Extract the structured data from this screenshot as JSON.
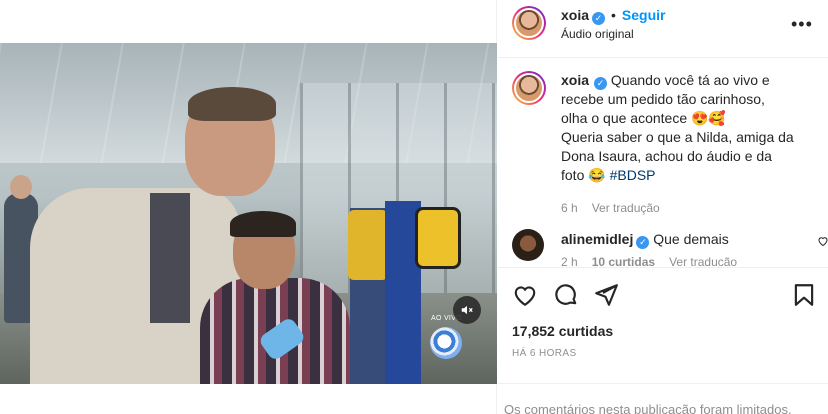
{
  "post_author": {
    "username": "xoia",
    "follow_label": "Seguir",
    "separator": "•",
    "audio_label": "Áudio original",
    "more_icon": "more-horizontal-icon",
    "more_label": "•••"
  },
  "video": {
    "overlay_text": "AO VIVO",
    "mute_icon": "speaker-muted-icon"
  },
  "caption": {
    "username": "xoia",
    "text_lines": [
      "Quando você tá ao vivo e",
      "recebe um pedido tão carinhoso,",
      "olha o que acontece 😍🥰",
      "Queria saber o que a Nilda, amiga da",
      "Dona Isaura, achou do áudio e da",
      "foto 😂"
    ],
    "hashtag": "#BDSP",
    "time": "6 h",
    "translate_label": "Ver tradução"
  },
  "comment": {
    "username": "alinemidlej",
    "text": "Que demais",
    "time": "2 h",
    "likes": "10 curtidas",
    "translate_label": "Ver tradução"
  },
  "actions": {
    "likes": "17,852 curtidas",
    "timestamp": "HÁ 6 HORAS",
    "limited_notice": "Os comentários nesta publicação foram limitados."
  },
  "colors": {
    "accent": "#0095f6",
    "verified": "#3897f0",
    "muted_text": "#8e8e8e"
  }
}
